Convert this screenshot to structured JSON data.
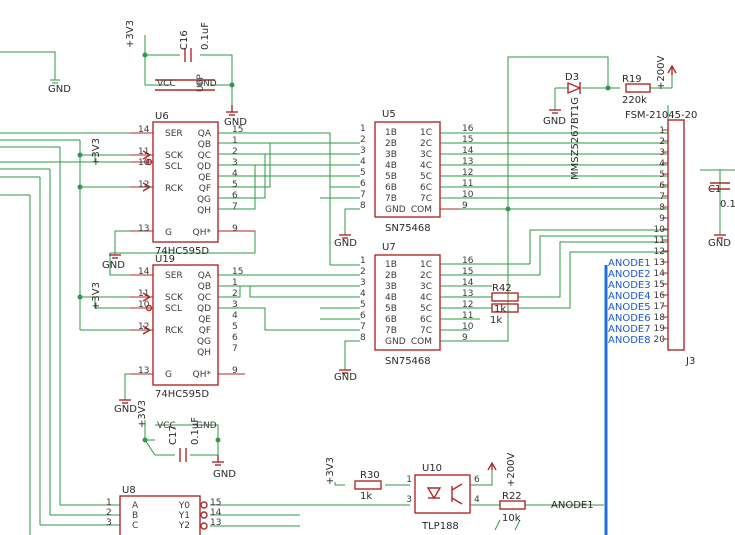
{
  "labels": {
    "gnd": "GND",
    "v33": "+3V3",
    "v200": "+200V",
    "u6": "U6",
    "u5": "U5",
    "u7": "U7",
    "u19": "U19",
    "u8": "U8",
    "u10": "U10",
    "d3": "D3",
    "j3": "J3",
    "c16": "C16",
    "c16_val": "0.1uF",
    "c1x": "C1",
    "c1x_val": "0.1",
    "c17": "C17",
    "c17_val": "0.1uF",
    "r19": "R19",
    "r19_val": "220k",
    "r30": "R30",
    "r30_val": "1k",
    "r22": "R22",
    "r22_val": "10k",
    "r42": "R42",
    "r43_val": "1k",
    "r44_val": "1k",
    "u6p": "U6P",
    "vcc": "VCC",
    "gnd_pin": "GND",
    "hc595_part": "74HC595D",
    "sn_part": "SN75468",
    "tlp_part": "TLP188",
    "d3_part": "MMSZ5267BT1G",
    "j3_part": "FSM-21045-20",
    "anode1": "ANODE1",
    "anode2": "ANODE2",
    "anode3": "ANODE3",
    "anode4": "ANODE4",
    "anode5": "ANODE5",
    "anode6": "ANODE6",
    "anode7": "ANODE7",
    "anode8": "ANODE8"
  },
  "hc595": {
    "left_pins": [
      "SER",
      "SCK",
      "SCL",
      "RCK",
      "G"
    ],
    "left_nums": [
      "14",
      "11",
      "10",
      "12",
      "13"
    ],
    "right_pins": [
      "QA",
      "QB",
      "QC",
      "QD",
      "QE",
      "QF",
      "QG",
      "QH",
      "QH*"
    ],
    "right_nums": [
      "15",
      "1",
      "2",
      "3",
      "4",
      "5",
      "6",
      "7",
      "9"
    ]
  },
  "sn75468": {
    "left_pins": [
      "1B",
      "2B",
      "3B",
      "4B",
      "5B",
      "6B",
      "7B",
      "GND"
    ],
    "left_nums": [
      "1",
      "2",
      "3",
      "4",
      "5",
      "6",
      "7",
      "8"
    ],
    "right_pins": [
      "1C",
      "2C",
      "3C",
      "4C",
      "5C",
      "6C",
      "7C",
      "COM"
    ],
    "right_nums": [
      "16",
      "15",
      "14",
      "13",
      "12",
      "11",
      "10",
      "9"
    ]
  },
  "u8": {
    "left_pins": [
      "A",
      "B",
      "C"
    ],
    "left_nums": [
      "1",
      "2",
      "3"
    ],
    "right_pins": [
      "Y0",
      "Y1",
      "Y2"
    ],
    "right_nums": [
      "15",
      "14",
      "13"
    ]
  },
  "tlp188": {
    "pins": [
      "1",
      "3",
      "6",
      "4"
    ]
  },
  "j3": {
    "pins": [
      "1",
      "2",
      "3",
      "4",
      "5",
      "6",
      "7",
      "8",
      "9",
      "10",
      "11",
      "12",
      "13",
      "14",
      "15",
      "16",
      "17",
      "18",
      "19",
      "20"
    ]
  },
  "colors": {
    "wire": "#2e9a46",
    "part": "#b22a2a",
    "bus": "#1f6fe0",
    "text": "#3a3a3a"
  }
}
